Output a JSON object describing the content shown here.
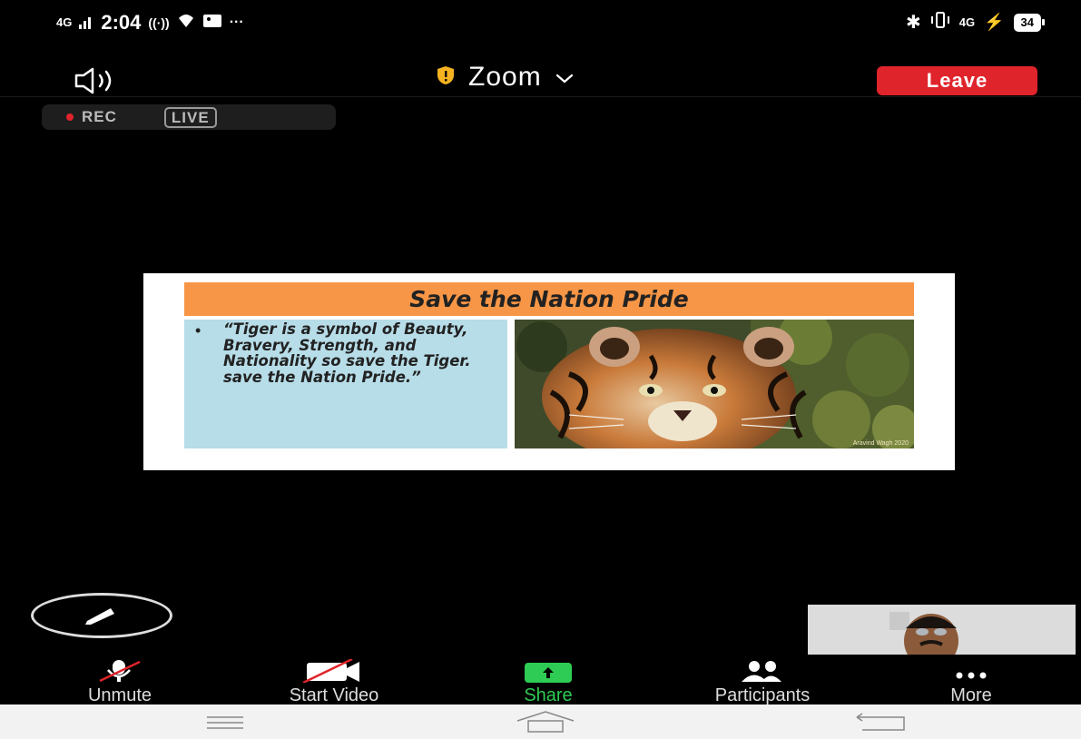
{
  "status_bar": {
    "network": "4G",
    "time": "2:04",
    "network_right": "4G",
    "battery": "34"
  },
  "meeting": {
    "title": "Zoom",
    "leave_label": "Leave",
    "rec_label": "REC",
    "live_label": "LIVE"
  },
  "slide": {
    "title": "Save the Nation Pride",
    "bullet": "•",
    "quote": "“Tiger is a symbol of Beauty, Bravery, Strength, and Nationality so save the Tiger. save the Nation Pride.”",
    "image_caption": "Aravind Wagh 2020"
  },
  "toolbar": {
    "unmute": "Unmute",
    "start_video": "Start Video",
    "share": "Share",
    "participants": "Participants",
    "more": "More"
  },
  "colors": {
    "leave": "#e0242b",
    "share": "#2ecc54",
    "slide_header": "#f79646",
    "slide_text_bg": "#b7dde8"
  }
}
